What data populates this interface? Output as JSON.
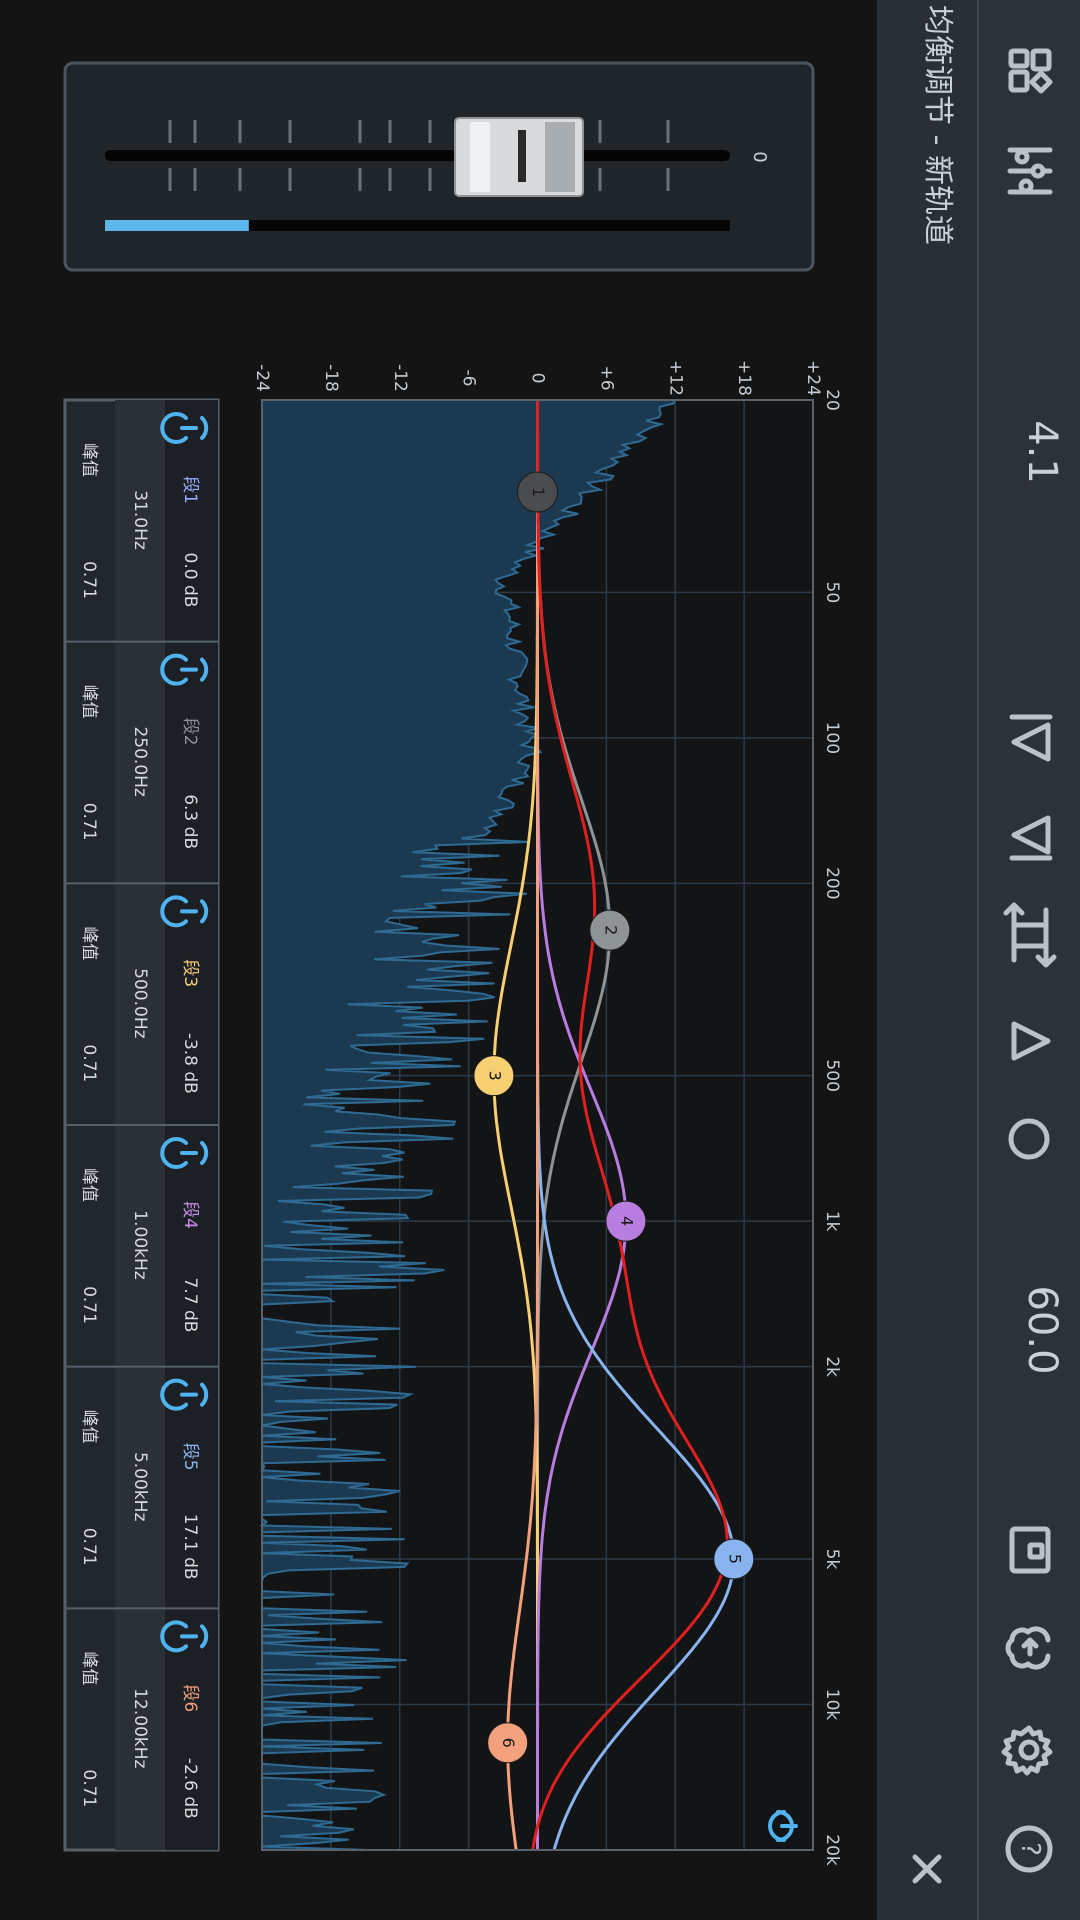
{
  "title": "均衡调节 - 新轨道",
  "toolbar": {
    "tempo": "60.0",
    "version_value": "4.1",
    "close_label": "×",
    "icons": [
      "grid-icon",
      "mixer-sliders-icon",
      "skip-back-icon",
      "skip-forward-icon",
      "loop-icon",
      "play-icon",
      "record-icon",
      "layout-icon",
      "cloud-icon",
      "settings-icon",
      "help-icon",
      "close-icon"
    ]
  },
  "slider": {
    "value_label": "0",
    "level_fraction": 0.23
  },
  "eq": {
    "freq_labels": [
      "20",
      "50",
      "100",
      "200",
      "500",
      "1k",
      "2k",
      "5k",
      "10k",
      "20k"
    ],
    "db_labels": [
      "+24",
      "+18",
      "+12",
      "+6",
      "0",
      "-6",
      "-12",
      "-18",
      "-24"
    ],
    "bands": [
      {
        "num": "1",
        "name": "段1",
        "freq": "31.0Hz",
        "gain": "0.0 dB",
        "q": "0.71",
        "type": "峰值",
        "color": "#4a4c4f"
      },
      {
        "num": "2",
        "name": "段2",
        "freq": "250.0Hz",
        "gain": "6.3 dB",
        "q": "0.71",
        "type": "峰值",
        "color": "#8e9496"
      },
      {
        "num": "3",
        "name": "段3",
        "freq": "500.0Hz",
        "gain": "-3.8 dB",
        "q": "0.71",
        "type": "峰值",
        "color": "#f5cf72"
      },
      {
        "num": "4",
        "name": "段4",
        "freq": "1.00kHz",
        "gain": "7.7 dB",
        "q": "0.71",
        "type": "峰值",
        "color": "#b77ee0"
      },
      {
        "num": "5",
        "name": "段5",
        "freq": "5.00kHz",
        "gain": "17.1 dB",
        "q": "0.71",
        "type": "峰值",
        "color": "#8ab4f0"
      },
      {
        "num": "6",
        "name": "段6",
        "freq": "12.00kHz",
        "gain": "-2.6 dB",
        "q": "0.71",
        "type": "峰值",
        "color": "#f3a07c"
      }
    ],
    "band_name_colors": [
      "#9aa8ff",
      "#8c9096",
      "#f5c97a",
      "#c58de8",
      "#8ab4f0",
      "#f3a07c"
    ]
  },
  "colors": {
    "accent": "#4fb3f0",
    "curve": "#e02020",
    "spectrum": "#1f4a66"
  }
}
